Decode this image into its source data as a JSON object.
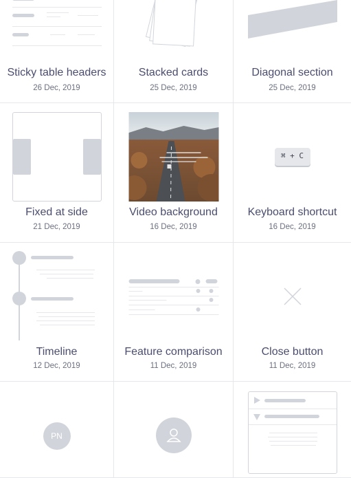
{
  "cards": [
    {
      "title": "Sticky table headers",
      "date": "26 Dec, 2019"
    },
    {
      "title": "Stacked cards",
      "date": "25 Dec, 2019"
    },
    {
      "title": "Diagonal section",
      "date": "25 Dec, 2019"
    },
    {
      "title": "Fixed at side",
      "date": "21 Dec, 2019"
    },
    {
      "title": "Video background",
      "date": "16 Dec, 2019"
    },
    {
      "title": "Keyboard shortcut",
      "date": "16 Dec, 2019"
    },
    {
      "title": "Timeline",
      "date": "12 Dec, 2019"
    },
    {
      "title": "Feature comparison",
      "date": "11 Dec, 2019"
    },
    {
      "title": "Close button",
      "date": "11 Dec, 2019"
    },
    {
      "avatar_initials": "PN"
    },
    {},
    {}
  ],
  "keyboard": {
    "keys": "⌘ + C"
  },
  "icons": {
    "close": "close-x-icon",
    "user": "user-icon"
  },
  "colors": {
    "title": "#4a4d6e",
    "date": "#6b6f80",
    "placeholder": "#d1d5db"
  }
}
